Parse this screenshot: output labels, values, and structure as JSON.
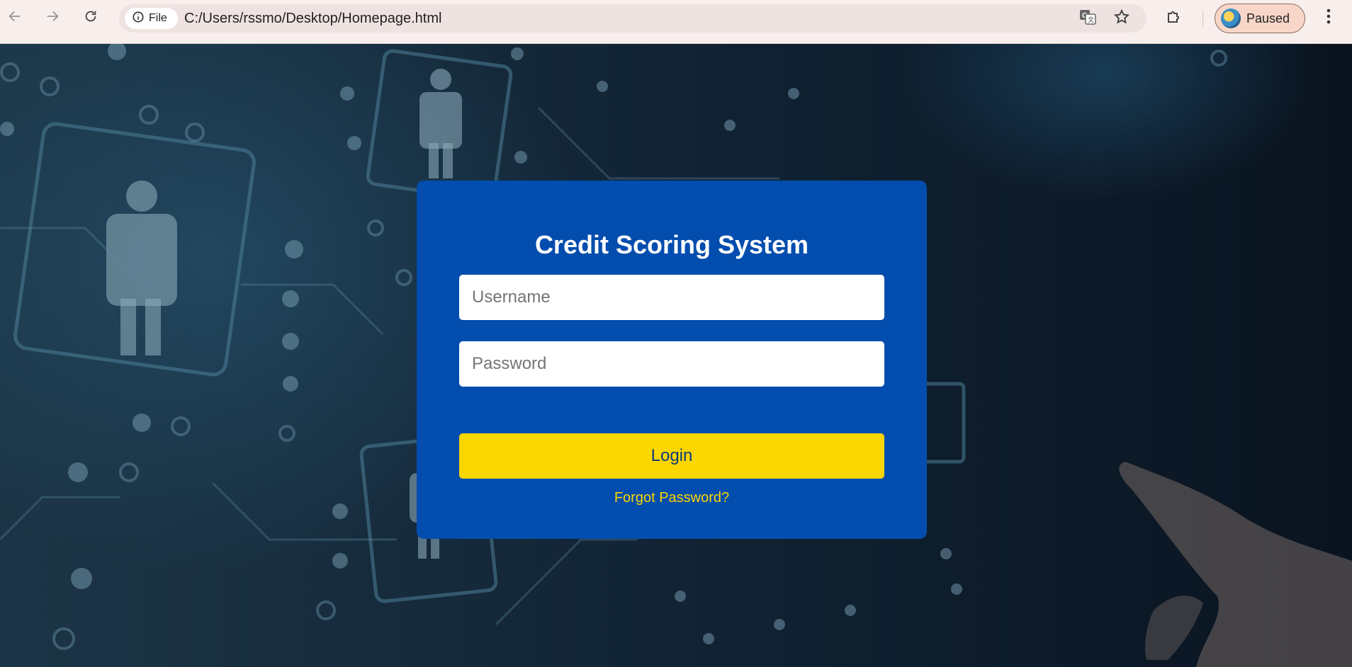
{
  "browser": {
    "back_icon": "arrow-left-icon",
    "forward_icon": "arrow-right-icon",
    "reload_icon": "reload-icon",
    "site_info_label": "File",
    "url": "C:/Users/rssmo/Desktop/Homepage.html",
    "translate_icon": "translate-icon",
    "bookmark_icon": "star-icon",
    "extensions_icon": "puzzle-icon",
    "profile_status": "Paused",
    "menu_icon": "more-vertical-icon"
  },
  "login_card": {
    "title": "Credit Scoring System",
    "username_placeholder": "Username",
    "password_placeholder": "Password",
    "login_label": "Login",
    "forgot_label": "Forgot Password?"
  },
  "colors": {
    "card_background": "#024dae",
    "accent": "#fcd600",
    "page_background": "#0f2030"
  }
}
